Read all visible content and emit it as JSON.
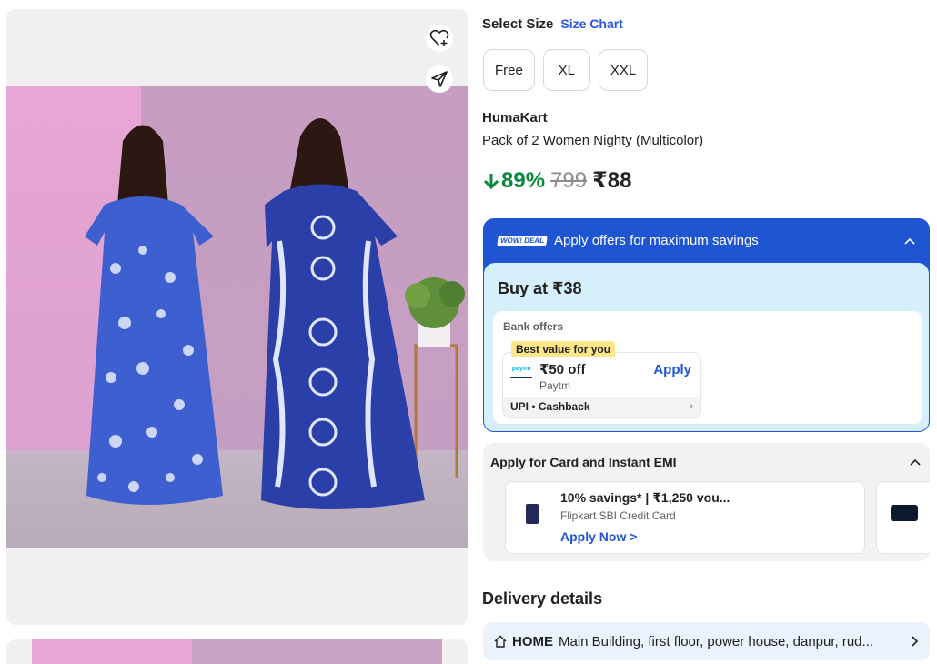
{
  "product_images": {
    "wishlist_icon": "heart-plus-icon",
    "share_icon": "send-icon"
  },
  "size": {
    "label": "Select Size",
    "chart_link": "Size Chart",
    "options": [
      "Free",
      "XL",
      "XXL"
    ]
  },
  "product": {
    "brand": "HumaKart",
    "title": "Pack of 2 Women Nighty (Multicolor)",
    "discount": "89%",
    "mrp": "799",
    "price": "₹88",
    "discount_color": "#088a3a"
  },
  "offers": {
    "badge": "WOW! DEAL",
    "heading": "Apply offers for maximum savings",
    "buy_at": "Buy at ₹38",
    "bank_label": "Bank offers",
    "best_tag": "Best value for you",
    "paytm_logo": "paytm",
    "amount": "₹50 off",
    "provider": "Paytm",
    "apply": "Apply",
    "footer": "UPI • Cashback",
    "accent": "#1f55d3"
  },
  "emi": {
    "title": "Apply for Card and Instant EMI",
    "item_head": "10% savings* | ₹1,250 vou...",
    "item_sub": "Flipkart SBI Credit Card",
    "item_link": "Apply Now >"
  },
  "delivery": {
    "title": "Delivery details",
    "home": "HOME",
    "address": "Main Building, first floor, power house, danpur, rud..."
  }
}
